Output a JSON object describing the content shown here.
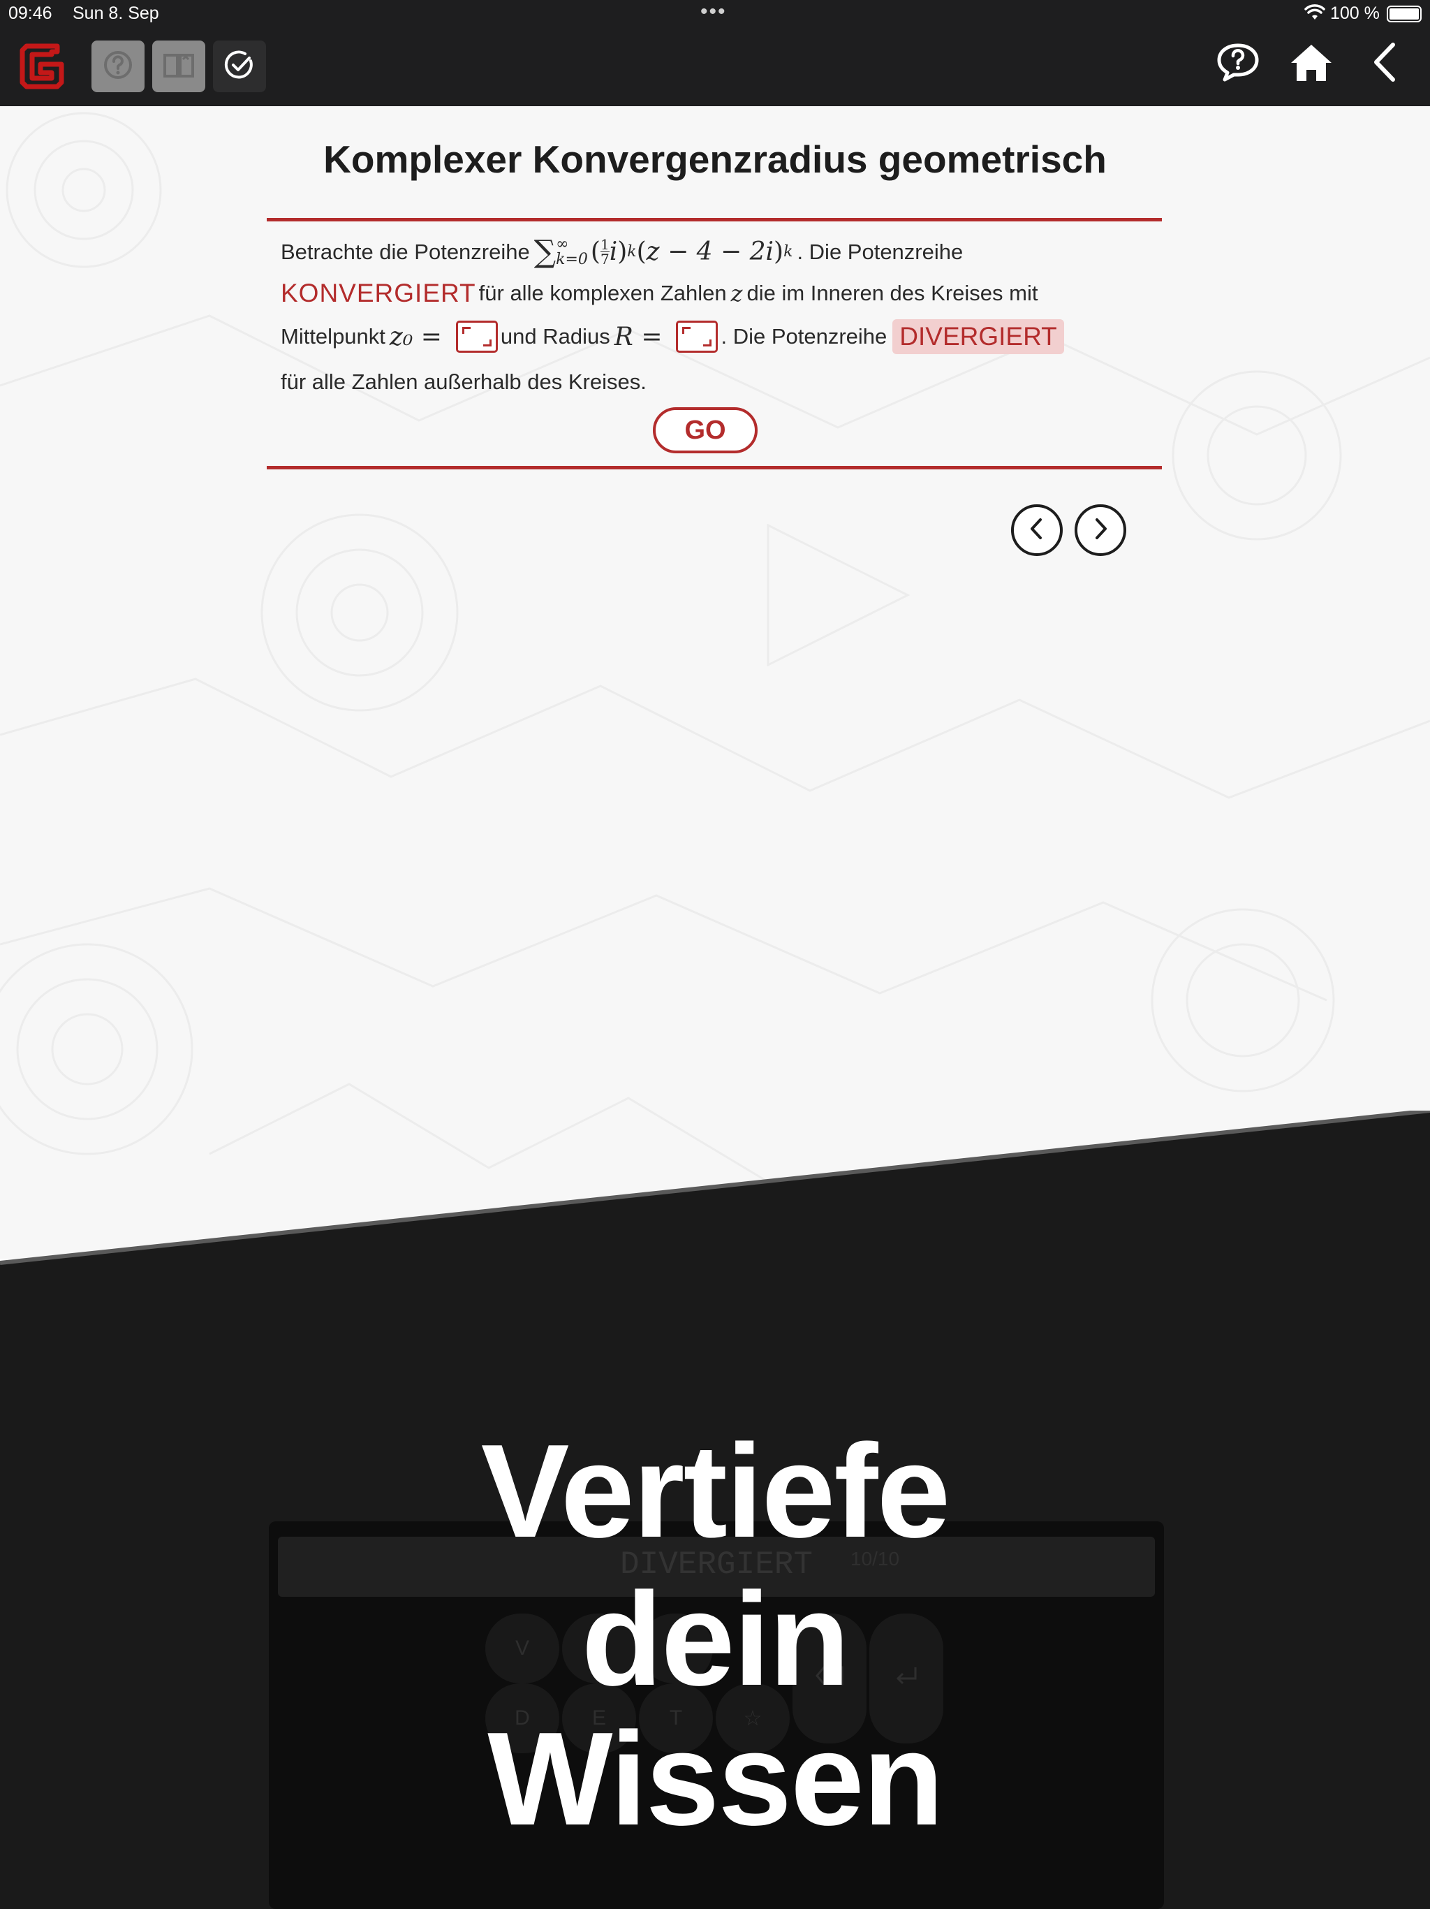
{
  "status_bar": {
    "time": "09:46",
    "date": "Sun 8. Sep",
    "dots": "•••",
    "battery": "100 %"
  },
  "exercise": {
    "title": "Komplexer Konvergenzradius geometrisch",
    "line1_prefix": "Betrachte die Potenzreihe",
    "formula": "∑_{k=0}^∞ (1/7 i)^k (z − 4 − 2i)^k",
    "line1_suffix": ". Die Potenzreihe",
    "keyword_converges": "KONVERGIERT",
    "line2_text": "für alle komplexen Zahlen",
    "line2_var": "z",
    "line2_suffix": "die im Inneren des Kreises mit",
    "line3_prefix": "Mittelpunkt",
    "line3_center_symbol": "z₀ =",
    "line3_mid": "und Radius",
    "line3_radius_symbol": "R =",
    "line3_suffix": ". Die Potenzreihe",
    "keyword_diverges": "DIVERGIERT",
    "line4_text": "für alle Zahlen außerhalb des Kreises.",
    "go_label": "GO"
  },
  "keyboard": {
    "field_value": "DIVERGIERT",
    "counter": "10/10",
    "keys_row1": [
      "V",
      "G",
      "I"
    ],
    "keys_row2": [
      "D",
      "E",
      "T",
      "☆"
    ]
  },
  "promo": {
    "line1": "Vertiefe",
    "line2": "dein",
    "line3": "Wissen"
  },
  "icons": {
    "logo": "app-logo",
    "help": "question-icon",
    "book": "book-icon",
    "check": "check-circle-icon",
    "feedback": "speech-question-icon",
    "home": "home-icon",
    "back": "chevron-left-icon"
  },
  "colors": {
    "accent": "#b32c2c",
    "topbar": "#1e1e1f",
    "keyword_bg": "#f2cfcf"
  }
}
